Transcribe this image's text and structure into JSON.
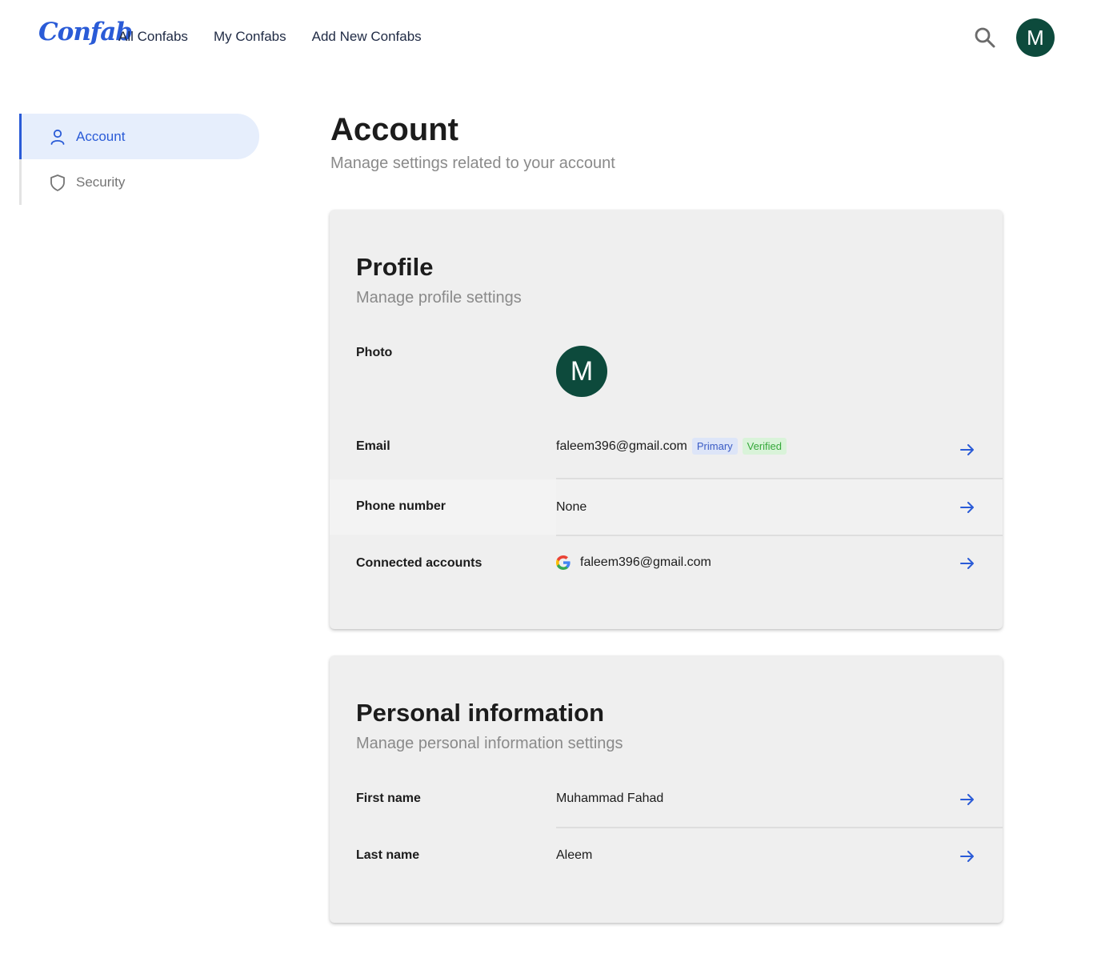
{
  "header": {
    "logo": "Confab",
    "nav": [
      "All Confabs",
      "My Confabs",
      "Add New Confabs"
    ],
    "avatar_initial": "M"
  },
  "sidebar": {
    "items": [
      {
        "label": "Account",
        "icon": "user-icon",
        "active": true
      },
      {
        "label": "Security",
        "icon": "shield-icon",
        "active": false
      }
    ]
  },
  "main": {
    "title": "Account",
    "subtitle": "Manage settings related to your account"
  },
  "profile": {
    "title": "Profile",
    "subtitle": "Manage profile settings",
    "photo_label": "Photo",
    "photo_initial": "M",
    "email_label": "Email",
    "email_value": "faleem396@gmail.com",
    "email_badge_primary": "Primary",
    "email_badge_verified": "Verified",
    "phone_label": "Phone number",
    "phone_value": "None",
    "connected_label": "Connected accounts",
    "connected_value": "faleem396@gmail.com"
  },
  "personal": {
    "title": "Personal information",
    "subtitle": "Manage personal information settings",
    "first_label": "First name",
    "first_value": "Muhammad Fahad",
    "last_label": "Last name",
    "last_value": "Aleem"
  },
  "colors": {
    "accent": "#2a5bd7",
    "avatar_bg": "#0d4a3c",
    "card_bg": "#efefef"
  }
}
